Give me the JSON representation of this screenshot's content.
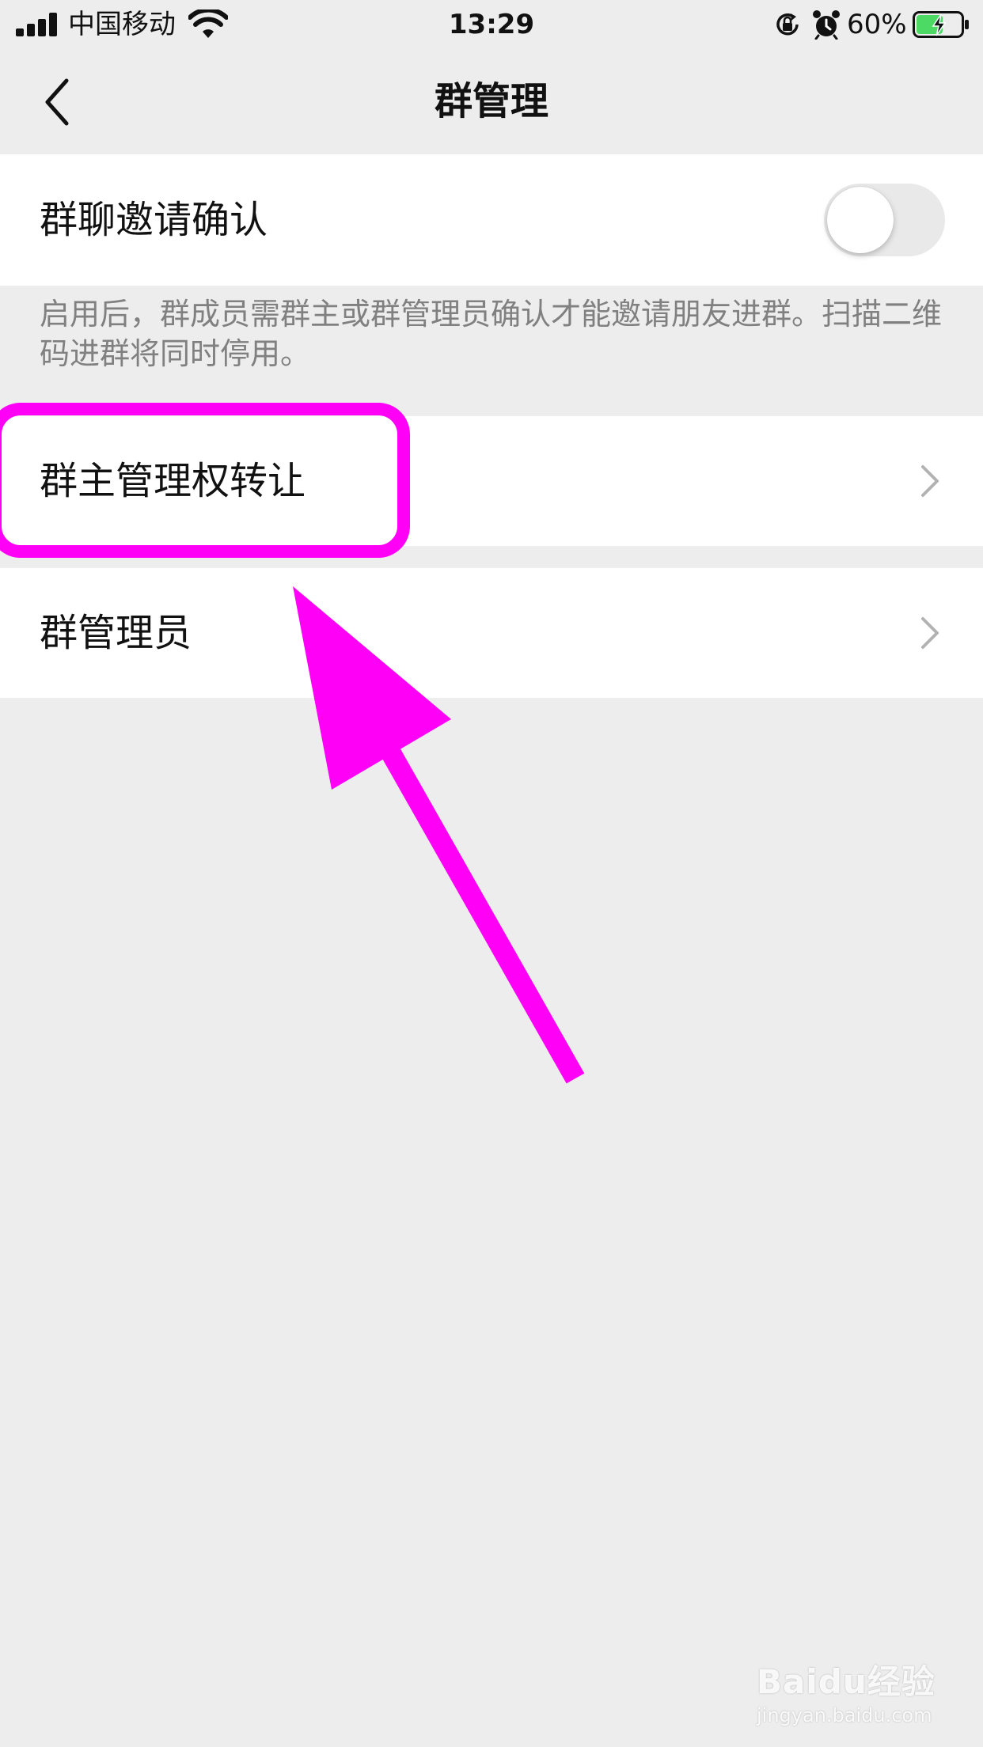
{
  "status_bar": {
    "carrier": "中国移动",
    "time": "13:29",
    "battery_percent": "60%",
    "battery_level": 0.6,
    "icons": [
      "signal-icon",
      "wifi-icon",
      "orientation-lock-icon",
      "alarm-icon",
      "battery-charging-icon"
    ]
  },
  "nav": {
    "back_icon": "chevron-left-icon",
    "title": "群管理"
  },
  "settings": {
    "invite_confirm": {
      "label": "群聊邀请确认",
      "enabled": false,
      "description": "启用后，群成员需群主或群管理员确认才能邀请朋友进群。扫描二维码进群将同时停用。"
    },
    "transfer_owner": {
      "label": "群主管理权转让",
      "icon": "chevron-right-icon"
    },
    "admins": {
      "label": "群管理员",
      "icon": "chevron-right-icon"
    }
  },
  "annotations": {
    "highlight_color": "#ff00f6",
    "arrow_color": "#ff00f6"
  },
  "watermark": {
    "brand": "Baidu经验",
    "url": "jingyan.baidu.com"
  }
}
